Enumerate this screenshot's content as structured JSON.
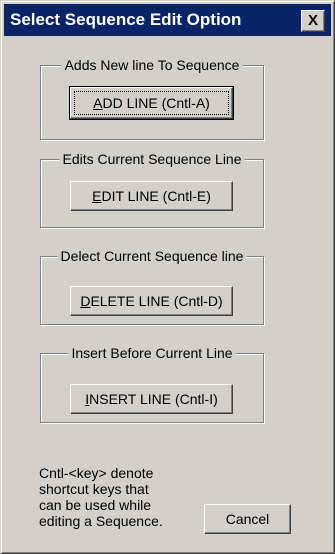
{
  "window": {
    "title": "Select Sequence Edit Option",
    "close_label": "X"
  },
  "groups": [
    {
      "label": "Adds New line To Sequence",
      "button": {
        "accel": "A",
        "rest": "DD LINE (Cntl-A)"
      }
    },
    {
      "label": "Edits Current Sequence Line",
      "button": {
        "accel": "E",
        "rest": "DIT LINE (Cntl-E)"
      }
    },
    {
      "label": "Delect Current Sequence line",
      "button": {
        "accel": "D",
        "rest": "ELETE LINE (Cntl-D)"
      }
    },
    {
      "label": "Insert Before Current Line",
      "button": {
        "accel": "I",
        "rest": "NSERT LINE (Cntl-I)"
      }
    }
  ],
  "help": {
    "lines": [
      "Cntl-<key> denote",
      "shortcut keys that",
      "can be used while",
      "editing a Sequence."
    ]
  },
  "cancel_label": "Cancel"
}
